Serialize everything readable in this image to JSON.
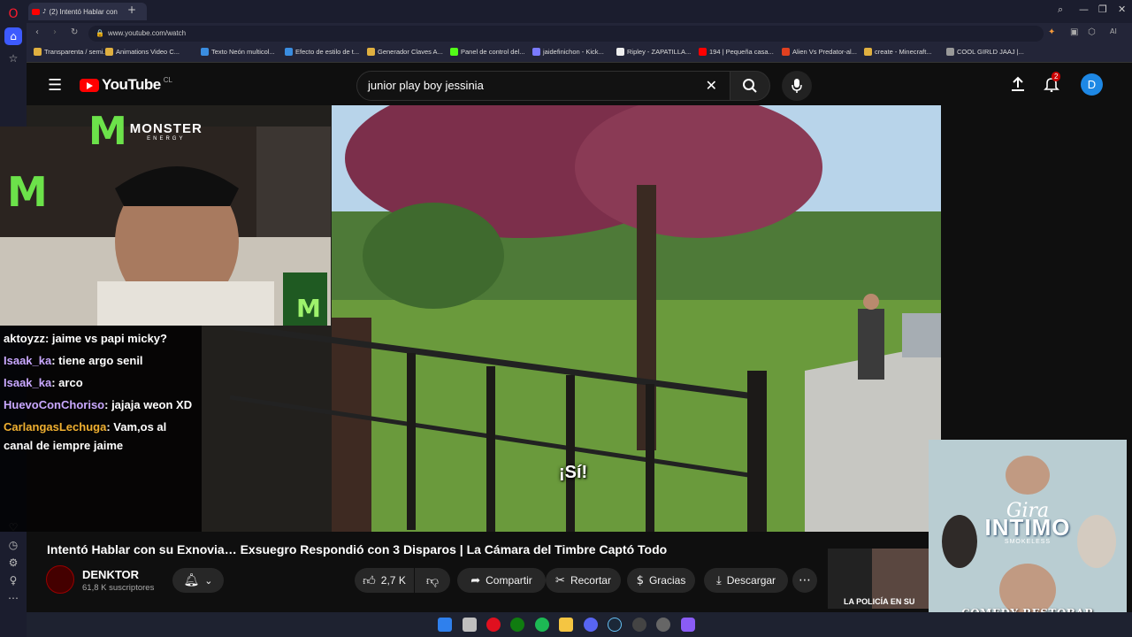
{
  "browser": {
    "tab_title": "(2) Intentó Hablar con",
    "url": "www.youtube.com/watch",
    "bookmarks": [
      {
        "label": "Transparenta / semi...",
        "color": "#e0b040"
      },
      {
        "label": "Animations Video C...",
        "color": "#e0b040"
      },
      {
        "label": "Texto Neón multicol...",
        "color": "#3a8de0"
      },
      {
        "label": "Efecto de estilo de t...",
        "color": "#3a8de0"
      },
      {
        "label": "Generador Claves A...",
        "color": "#e0b040"
      },
      {
        "label": "Panel de control del...",
        "color": "#53fc18"
      },
      {
        "label": "jaidefinichon - Kick...",
        "color": "#7a7aff"
      },
      {
        "label": "Ripley - ZAPATILLA...",
        "color": "#eeeeee"
      },
      {
        "label": "194 | Pequeña casa...",
        "color": "#ff0000"
      },
      {
        "label": "Alien Vs Predator-al...",
        "color": "#e04020"
      },
      {
        "label": "create - Minecraft...",
        "color": "#e0b040"
      },
      {
        "label": "COOL GIRLD JAAJ |...",
        "color": "#999999"
      }
    ]
  },
  "youtube": {
    "logo_text": "YouTube",
    "country_code": "CL",
    "search_query": "junior play boy jessinia",
    "notification_count": "2",
    "avatar_letter": "D"
  },
  "video": {
    "title": "Intentó Hablar con su Exnovia… Exsuegro Respondió con 3 Disparos | La Cámara del Timbre Captó Todo",
    "subtitle": "¡Sí!",
    "channel_name": "DENKTOR",
    "subscribers": "61,8 K suscriptores",
    "likes": "2,7 K",
    "share_label": "Compartir",
    "clip_label": "Recortar",
    "thanks_label": "Gracias",
    "download_label": "Descargar"
  },
  "overlay": {
    "sponsor_name": "MONSTER",
    "sponsor_sub": "ENERGY",
    "chat": [
      {
        "user": "aktoyzz",
        "text": ": jaime vs papi micky?",
        "color": "#ffffff"
      },
      {
        "user": "Isaak_ka",
        "text": ": tiene argo senil",
        "color": "#c9a8ff"
      },
      {
        "user": "Isaak_ka",
        "text": ": arco",
        "color": "#c9a8ff"
      },
      {
        "user": "HuevoConChoriso",
        "text": ": jajaja weon XD",
        "color": "#c9a8ff"
      },
      {
        "user": "CarlangasLechuga",
        "text": ": Vam,os al canal de iempre jaime",
        "color": "#f0b030"
      }
    ]
  },
  "promo": {
    "tour_line1": "Gira",
    "tour_line2": "INTIMO",
    "artist": "SMOKELESS",
    "venue": "COMEDY RESTOBAR"
  },
  "sidebar_thumb": {
    "caption": "LA POLICÍA EN SU"
  }
}
